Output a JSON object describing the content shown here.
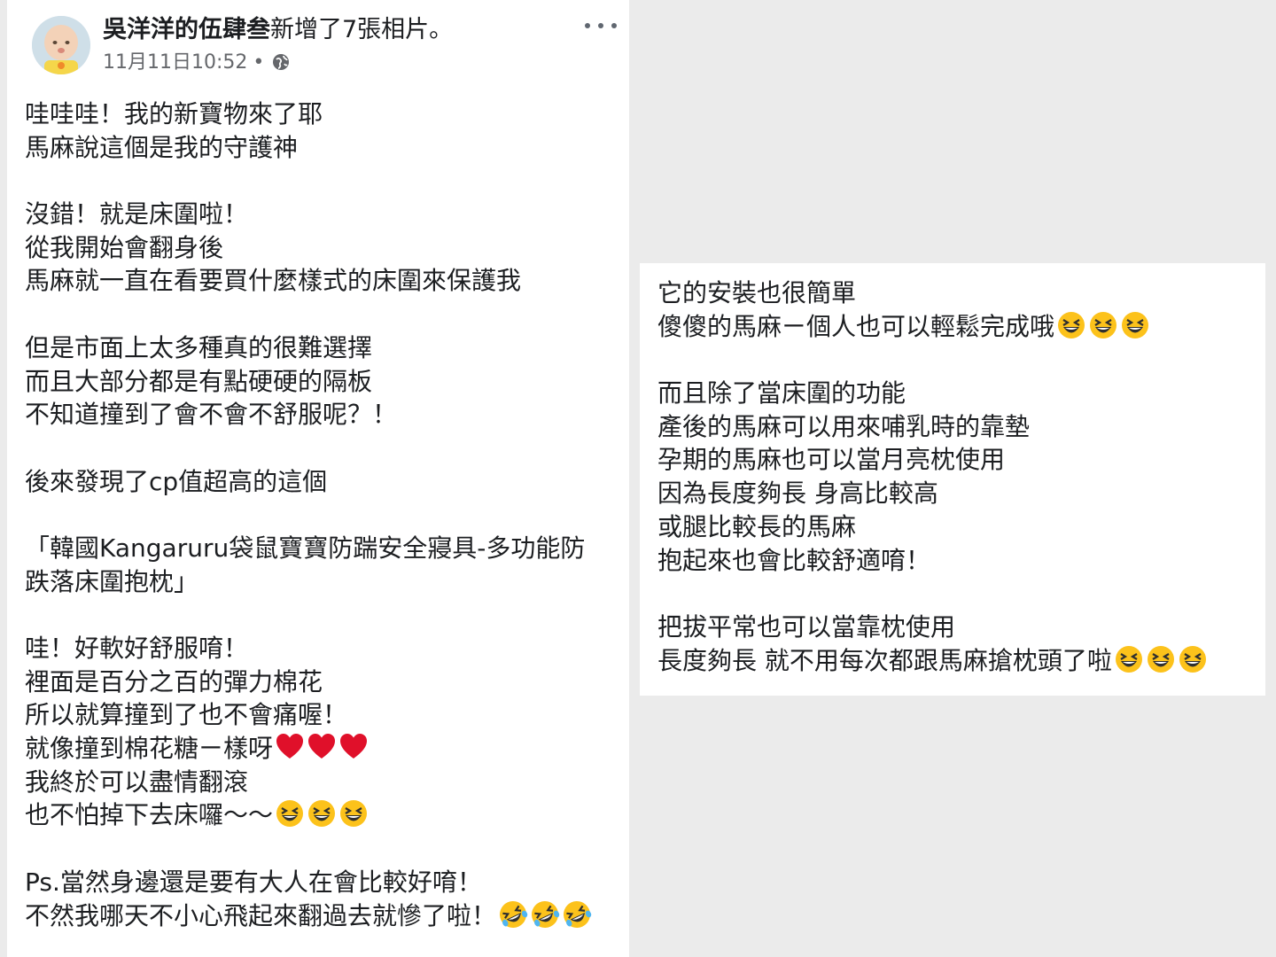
{
  "post": {
    "author_name": "吳洋洋的伍肆叁",
    "action_text": "新增了7張相片。",
    "timestamp": "11月11日10:52",
    "separator": "•",
    "privacy_icon": "globe-icon",
    "more_icon": "more-options-icon"
  },
  "left_text": {
    "l1": "哇哇哇！我的新寶物來了耶",
    "l2": "馬麻說這個是我的守護神",
    "l3": "沒錯！就是床圍啦！",
    "l4": "從我開始會翻身後",
    "l5": "馬麻就一直在看要買什麼樣式的床圍來保護我",
    "l6": "但是市面上太多種真的很難選擇",
    "l7": "而且大部分都是有點硬硬的隔板",
    "l8": "不知道撞到了會不會不舒服呢？！",
    "l9": "後來發現了cp值超高的這個",
    "l10": "「韓國Kangaruru袋鼠寶寶防踹安全寢具-多功能防",
    "l11": "跌落床圍抱枕」",
    "l12": "哇！好軟好舒服唷！",
    "l13": "裡面是百分之百的彈力棉花",
    "l14": "所以就算撞到了也不會痛喔！",
    "l15": "就像撞到棉花糖ㄧ樣呀",
    "l16": "我終於可以盡情翻滾",
    "l17": "也不怕掉下去床囉～～",
    "l18": "Ps.當然身邊還是要有大人在會比較好唷！",
    "l19": "不然我哪天不小心飛起來翻過去就慘了啦！"
  },
  "right_text": {
    "r1": "它的安裝也很簡單",
    "r2": "傻傻的馬麻ㄧ個人也可以輕鬆完成哦",
    "r3": "而且除了當床圍的功能",
    "r4": "產後的馬麻可以用來哺乳時的靠墊",
    "r5": "孕期的馬麻也可以當月亮枕使用",
    "r6": "因為長度夠長 身高比較高",
    "r7": "或腿比較長的馬麻",
    "r8": "抱起來也會比較舒適唷！",
    "r9": "把拔平常也可以當靠枕使用",
    "r10": "長度夠長 就不用每次都跟馬麻搶枕頭了啦"
  },
  "emojis": {
    "heart": "red-heart-emoji",
    "laugh": "grinning-squinting-emoji",
    "rofl": "rolling-on-floor-laughing-emoji"
  },
  "colors": {
    "background": "#ebebeb",
    "card": "#ffffff",
    "text": "#1c1e21",
    "meta": "#65676b",
    "heart": "#e0102a",
    "emoji_yellow": "#fcc21b"
  }
}
